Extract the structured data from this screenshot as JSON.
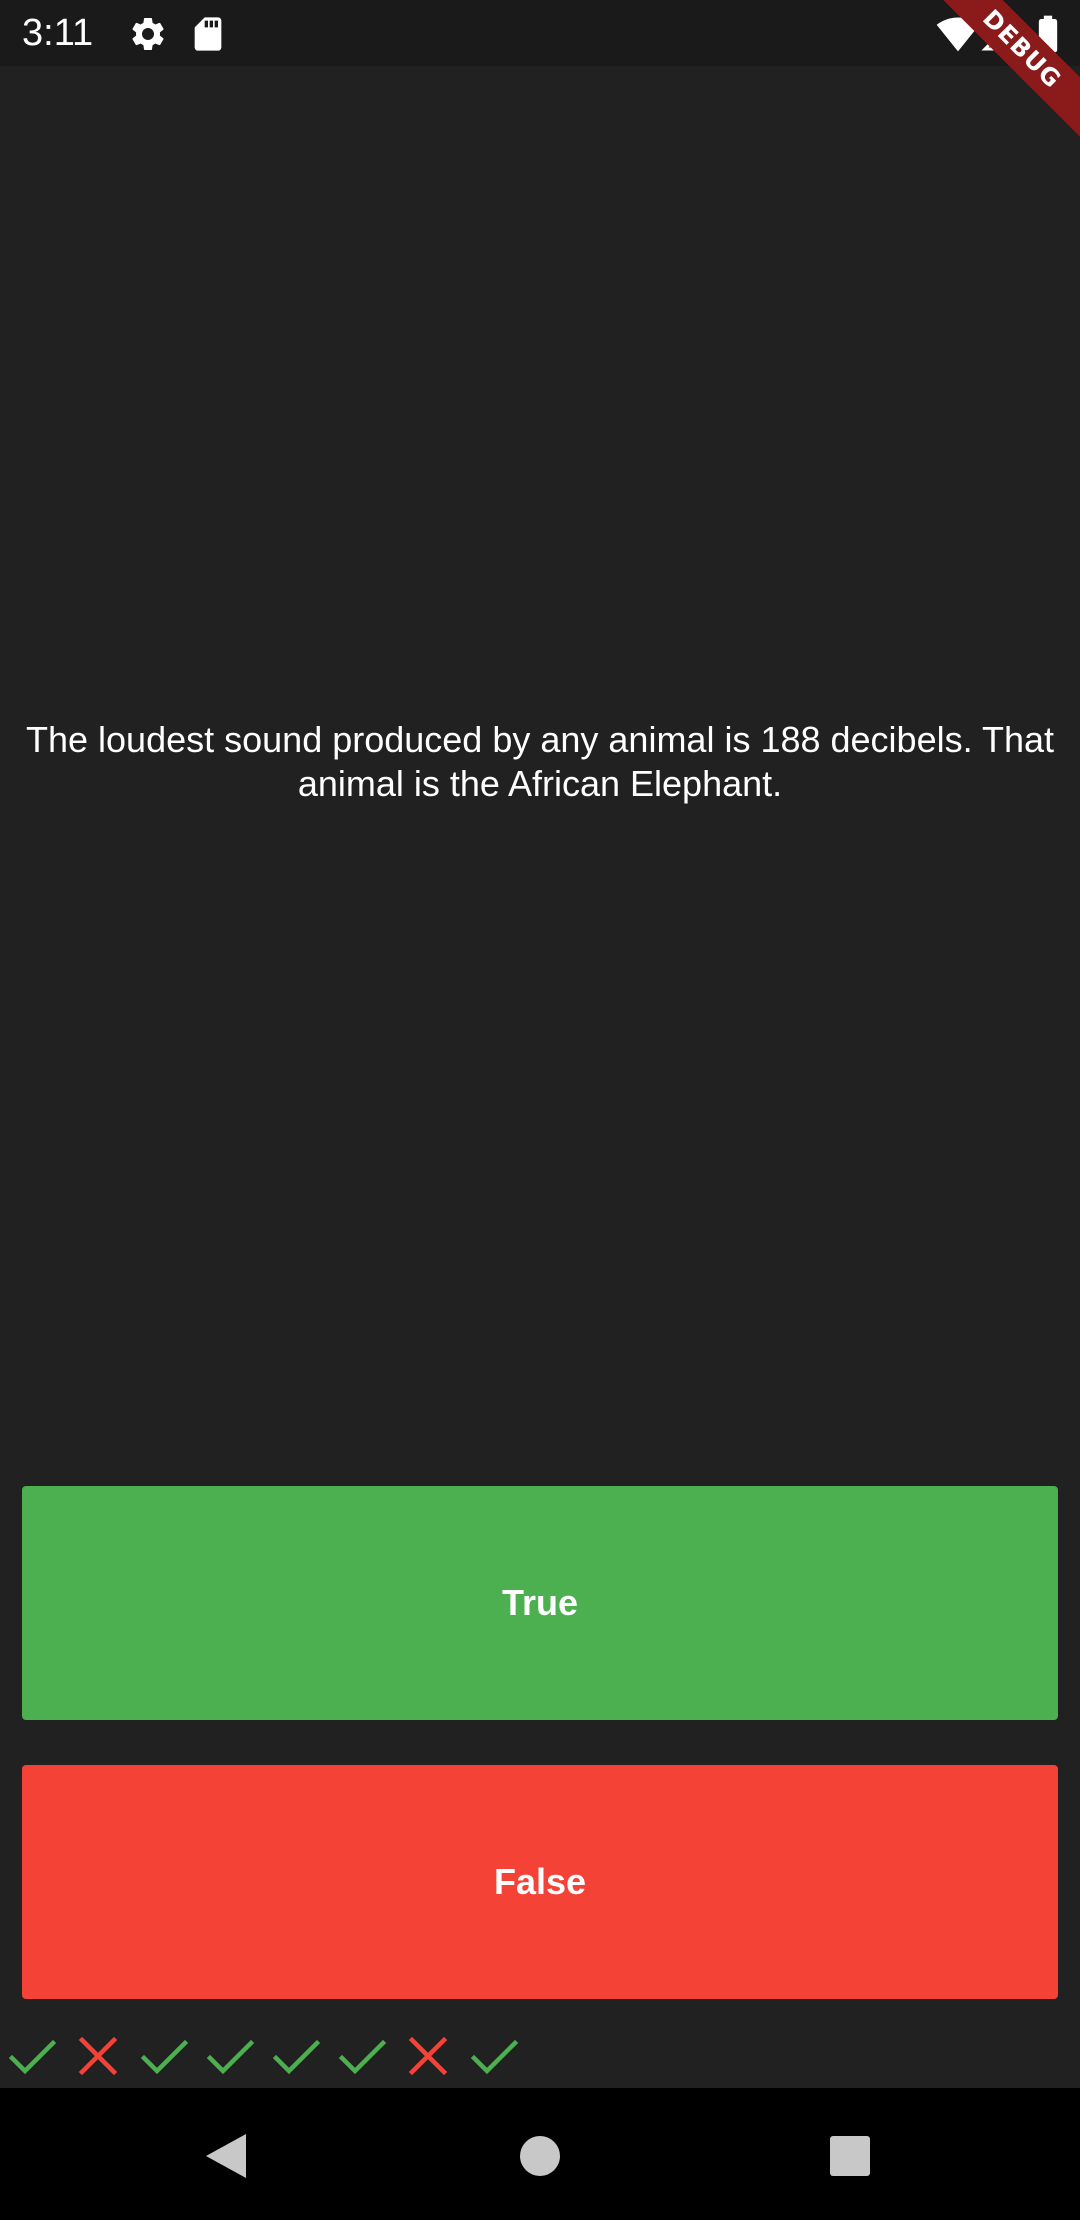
{
  "status_bar": {
    "time": "3:11",
    "icons": [
      "gear-icon",
      "sd-card-icon",
      "wifi-icon",
      "cellular-signal-icon",
      "battery-icon"
    ]
  },
  "debug_banner": {
    "label": "DEBUG",
    "color": "#8b1a1a"
  },
  "question": {
    "text": "The loudest sound produced by any animal is 188 decibels. That animal is the African Elephant."
  },
  "buttons": {
    "true_label": "True",
    "false_label": "False",
    "true_color": "#4caf50",
    "false_color": "#f44336"
  },
  "score_keeper": {
    "results": [
      "correct",
      "wrong",
      "correct",
      "correct",
      "correct",
      "correct",
      "wrong",
      "correct"
    ],
    "correct_color": "#4caf50",
    "wrong_color": "#f44336"
  },
  "nav_bar": {
    "icons": [
      "back-triangle-icon",
      "home-circle-icon",
      "recents-square-icon"
    ]
  },
  "colors": {
    "background": "#212121",
    "status_bar": "#1a1a1a",
    "nav_bar": "#000000"
  }
}
